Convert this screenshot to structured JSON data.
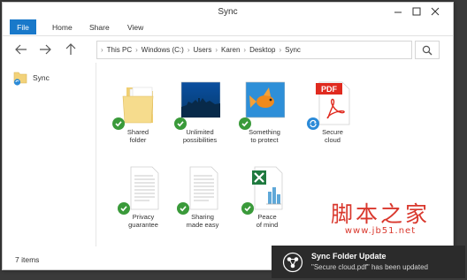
{
  "window": {
    "title": "Sync"
  },
  "ribbon": {
    "tabs": [
      "File",
      "Home",
      "Share",
      "View"
    ]
  },
  "address": {
    "crumbs": [
      "This PC",
      "Windows (C:)",
      "Users",
      "Karen",
      "Desktop",
      "Sync"
    ]
  },
  "sidebar": {
    "items": [
      {
        "label": "Sync",
        "icon": "sync-folder-icon"
      }
    ]
  },
  "files": [
    {
      "label": "Shared\nfolder",
      "icon": "folder-icon",
      "status": "synced"
    },
    {
      "label": "Unlimited\npossibilities",
      "icon": "image-icon",
      "status": "synced"
    },
    {
      "label": "Something\nto protect",
      "icon": "image-icon",
      "status": "synced"
    },
    {
      "label": "Secure\ncloud",
      "icon": "pdf-icon",
      "badge_text": "PDF",
      "status": "syncing"
    },
    {
      "label": "Privacy\nguarantee",
      "icon": "document-icon",
      "status": "synced"
    },
    {
      "label": "Sharing\nmade easy",
      "icon": "document-icon",
      "status": "synced"
    },
    {
      "label": "Peace\nof mind",
      "icon": "excel-icon",
      "status": "synced"
    }
  ],
  "status": {
    "item_count": "7 items"
  },
  "toast": {
    "title": "Sync Folder Update",
    "body": "\"Secure cloud.pdf\" has been updated"
  },
  "watermark": {
    "main": "脚本之家",
    "url": "www.jb51.net"
  },
  "colors": {
    "accent": "#1979ca",
    "synced": "#3a9a3a",
    "syncing": "#2b8ad8",
    "toast_bg": "#2b2b2b",
    "watermark": "#d9372c"
  }
}
